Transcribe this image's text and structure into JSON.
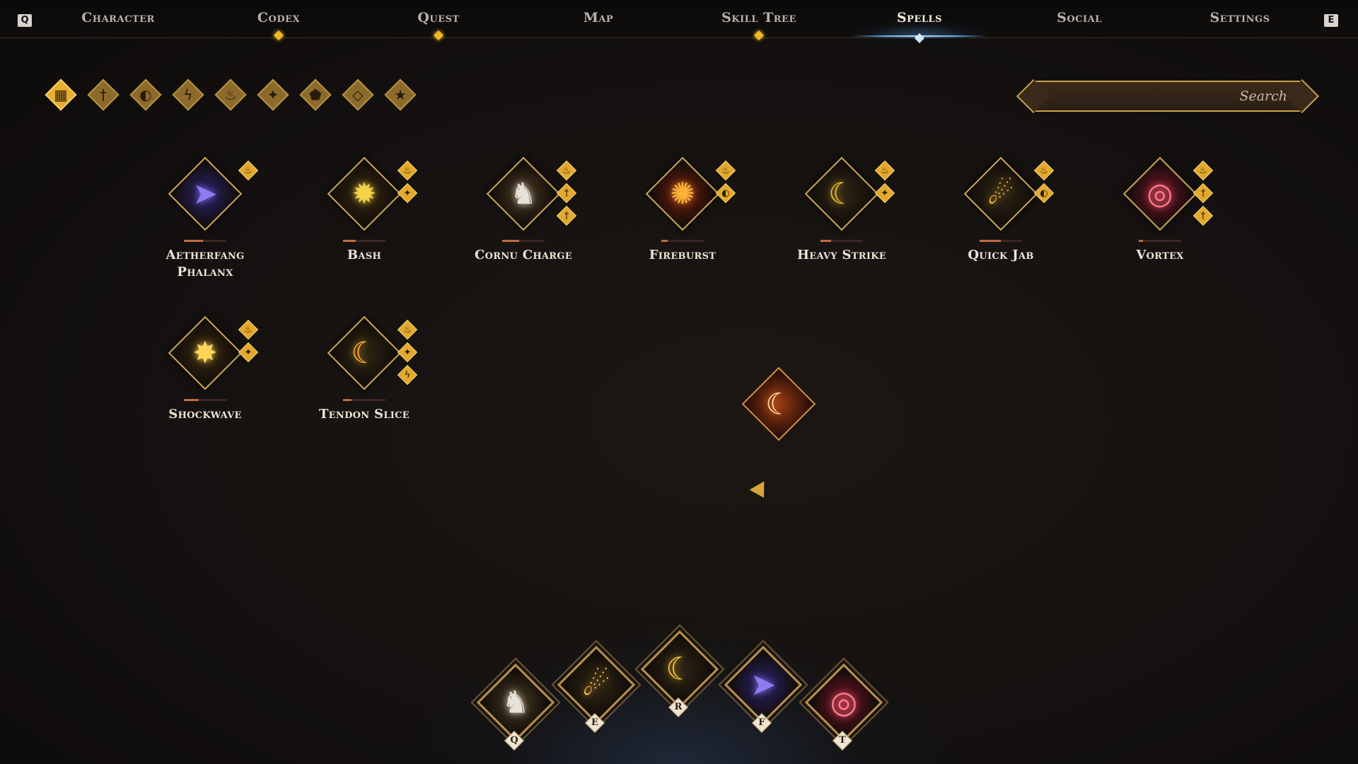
{
  "nav": {
    "left_key": "Q",
    "right_key": "E",
    "tabs": [
      {
        "label": "Character",
        "has_dot": false,
        "active": false
      },
      {
        "label": "Codex",
        "has_dot": true,
        "active": false
      },
      {
        "label": "Quest",
        "has_dot": true,
        "active": false
      },
      {
        "label": "Map",
        "has_dot": false,
        "active": false
      },
      {
        "label": "Skill Tree",
        "has_dot": true,
        "active": false
      },
      {
        "label": "Spells",
        "has_dot": false,
        "active": true
      },
      {
        "label": "Social",
        "has_dot": false,
        "active": false
      },
      {
        "label": "Settings",
        "has_dot": false,
        "active": false
      }
    ]
  },
  "filters": [
    {
      "name": "all-filter-icon",
      "glyph": "▦",
      "active": true
    },
    {
      "name": "sword-filter-icon",
      "glyph": "†",
      "active": false
    },
    {
      "name": "helmet-filter-icon",
      "glyph": "◐",
      "active": false
    },
    {
      "name": "lightning-filter-icon",
      "glyph": "ϟ",
      "active": false
    },
    {
      "name": "fire-filter-icon",
      "glyph": "♨",
      "active": false
    },
    {
      "name": "target-filter-icon",
      "glyph": "✦",
      "active": false
    },
    {
      "name": "shield-filter-icon",
      "glyph": "⬟",
      "active": false
    },
    {
      "name": "gem-filter-icon",
      "glyph": "◇",
      "active": false
    },
    {
      "name": "star-filter-icon",
      "glyph": "★",
      "active": false
    }
  ],
  "search": {
    "placeholder": "Search",
    "value": ""
  },
  "spells": [
    {
      "name": "Aetherfang Phalanx",
      "icon": "spear-burst-icon",
      "glyph": "➤",
      "color": "#8f7cf0",
      "bg": "#2b2370",
      "tags": [
        "♨"
      ],
      "progress": 0.45
    },
    {
      "name": "Bash",
      "icon": "impact-burst-icon",
      "glyph": "✹",
      "color": "#f3d34a",
      "bg": "#3a2a0e",
      "tags": [
        "♨",
        "✦"
      ],
      "progress": 0.3
    },
    {
      "name": "Cornu Charge",
      "icon": "rhino-charge-icon",
      "glyph": "♞",
      "color": "#e7e2d8",
      "bg": "#4a3a22",
      "tags": [
        "♨",
        "†",
        "†"
      ],
      "progress": 0.4
    },
    {
      "name": "Fireburst",
      "icon": "fire-burst-icon",
      "glyph": "✺",
      "color": "#ffb23a",
      "bg": "#7a1d0c",
      "tags": [
        "♨",
        "◐"
      ],
      "progress": 0.15
    },
    {
      "name": "Heavy Strike",
      "icon": "crescent-strike-icon",
      "glyph": "☾",
      "color": "#f7c53a",
      "bg": "#2f2614",
      "tags": [
        "♨",
        "✦"
      ],
      "progress": 0.25
    },
    {
      "name": "Quick Jab",
      "icon": "fireball-icon",
      "glyph": "☄",
      "color": "#ffbe3a",
      "bg": "#2f2614",
      "tags": [
        "♨",
        "◐"
      ],
      "progress": 0.5
    },
    {
      "name": "Vortex",
      "icon": "vortex-icon",
      "glyph": "◎",
      "color": "#ff7a8a",
      "bg": "#7a1227",
      "tags": [
        "♨",
        "†",
        "†"
      ],
      "progress": 0.1
    },
    {
      "name": "Shockwave",
      "icon": "shockwave-icon",
      "glyph": "✸",
      "color": "#ffd35a",
      "bg": "#3b2a0e",
      "tags": [
        "♨",
        "✦"
      ],
      "progress": 0.35
    },
    {
      "name": "Tendon Slice",
      "icon": "slice-icon",
      "glyph": "☾",
      "color": "#ffb23a",
      "bg": "#2f2614",
      "tags": [
        "♨",
        "✦",
        "ϟ"
      ],
      "progress": 0.2
    }
  ],
  "dragged_spell": {
    "icon": "crescent-fire-icon",
    "glyph": "☾",
    "color": "#ffe2a6",
    "bg": "#9a3a14"
  },
  "hotbar": [
    {
      "key": "Q",
      "icon": "rhino-charge-icon",
      "glyph": "♞",
      "color": "#e7e2d8",
      "bg": "#4a3a22"
    },
    {
      "key": "E",
      "icon": "fireball-icon",
      "glyph": "☄",
      "color": "#ffbe3a",
      "bg": "#2f2614"
    },
    {
      "key": "R",
      "icon": "crescent-strike-icon",
      "glyph": "☾",
      "color": "#f7c53a",
      "bg": "#2f2614"
    },
    {
      "key": "F",
      "icon": "spear-burst-icon",
      "glyph": "➤",
      "color": "#8f7cf0",
      "bg": "#2b2370"
    },
    {
      "key": "T",
      "icon": "vortex-icon",
      "glyph": "◎",
      "color": "#ff7a8a",
      "bg": "#7a1227"
    }
  ],
  "colors": {
    "accent_gold": "#e3a92c",
    "active_blue": "#6fb0ee",
    "bg": "#141110"
  }
}
